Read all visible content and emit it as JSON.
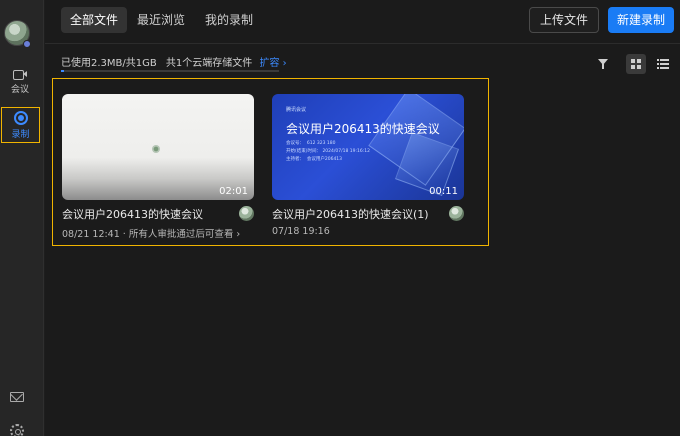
{
  "sidebar": {
    "items": [
      {
        "label": "会议"
      },
      {
        "label": "录制"
      }
    ]
  },
  "tabs": [
    {
      "label": "全部文件"
    },
    {
      "label": "最近浏览"
    },
    {
      "label": "我的录制"
    }
  ],
  "actions": {
    "upload_label": "上传文件",
    "new_label": "新建录制"
  },
  "storage": {
    "usage_text": "已使用2.3MB/共1GB",
    "count_text": "共1个云端存储文件",
    "expand_label": "扩容",
    "expand_arrow": "›"
  },
  "colors": {
    "accent": "#1a7cf5",
    "highlight": "#f0b400"
  },
  "cards": [
    {
      "title": "会议用户206413的快速会议",
      "duration": "02:01",
      "subtitle": "08/21 12:41 · 所有人审批通过后可查看 ›",
      "thumbnail": "light"
    },
    {
      "title": "会议用户206413的快速会议(1)",
      "duration": "00:11",
      "subtitle": "07/18 19:16",
      "thumbnail": "blue",
      "thumb_brand": "腾讯会议",
      "thumb_title": "会议用户206413的快速会议",
      "thumb_meta": "会议号：  612 323 180\n开始(结束)时间： 2024/07/18 19:16:12\n主持者：  会议用户206413"
    }
  ]
}
